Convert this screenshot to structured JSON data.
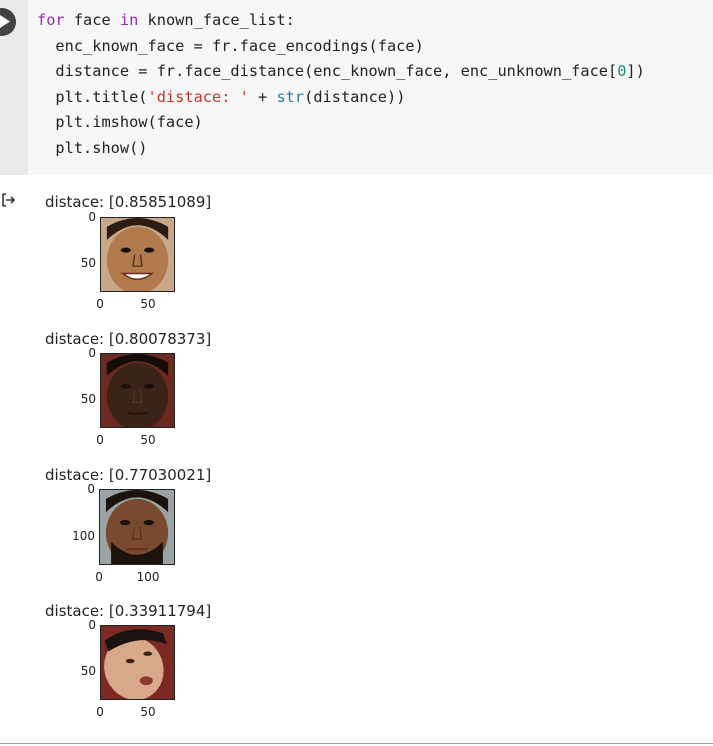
{
  "code_cell": {
    "lines": [
      [
        {
          "t": "for",
          "c": "kw"
        },
        {
          "t": " face "
        },
        {
          "t": "in",
          "c": "kw"
        },
        {
          "t": " known_face_list:"
        }
      ],
      [
        {
          "t": "  enc_known_face = fr.face_encodings(face)"
        }
      ],
      [
        {
          "t": "  distance = fr.face_distance(enc_known_face, enc_unknown_face["
        },
        {
          "t": "0",
          "c": "num"
        },
        {
          "t": "])"
        }
      ],
      [
        {
          "t": "  plt.title("
        },
        {
          "t": "'distace: '",
          "c": "str"
        },
        {
          "t": " + "
        },
        {
          "t": "str",
          "c": "fn"
        },
        {
          "t": "(distance))"
        }
      ],
      [
        {
          "t": "  plt.imshow(face)"
        }
      ],
      [
        {
          "t": "  plt.show()"
        }
      ]
    ],
    "run_icon": "play-icon"
  },
  "output": {
    "icon": "output-arrow-icon",
    "plots": [
      {
        "title": "distace: [0.85851089]",
        "y_ticks": [
          "0",
          "50"
        ],
        "x_ticks": [
          "0",
          "50"
        ],
        "image": "face-photo-smiling",
        "colors": {
          "bg": "#c9a88a",
          "skin": "#b07a4c",
          "hair": "#2b1c12"
        }
      },
      {
        "title": "distace: [0.80078373]",
        "y_ticks": [
          "0",
          "50"
        ],
        "x_ticks": [
          "0",
          "50"
        ],
        "image": "face-photo-serious",
        "colors": {
          "bg": "#6b2a1f",
          "skin": "#3b2318",
          "hair": "#150c08"
        }
      },
      {
        "title": "distace: [0.77030021]",
        "y_ticks": [
          "0",
          "100"
        ],
        "x_ticks": [
          "0",
          "100"
        ],
        "image": "face-photo-bearded",
        "colors": {
          "bg": "#9aa4a6",
          "skin": "#7a4a2e",
          "hair": "#1c120c"
        }
      },
      {
        "title": "distace: [0.33911794]",
        "y_ticks": [
          "0",
          "50"
        ],
        "x_ticks": [
          "0",
          "50"
        ],
        "image": "face-photo-tilted",
        "colors": {
          "bg": "#7a2a22",
          "skin": "#d8a88a",
          "hair": "#1a1210"
        }
      }
    ]
  }
}
